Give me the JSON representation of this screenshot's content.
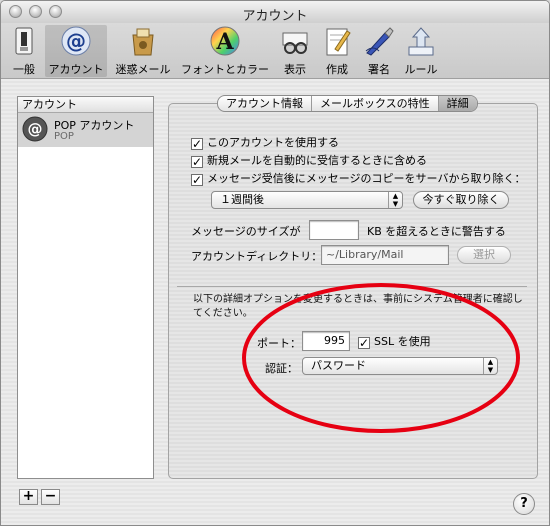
{
  "window": {
    "title": "アカウント"
  },
  "toolbar": {
    "items": [
      {
        "label": "一般",
        "icon": "switch-icon"
      },
      {
        "label": "アカウント",
        "icon": "at-sign-icon"
      },
      {
        "label": "迷惑メール",
        "icon": "junk-bag-icon"
      },
      {
        "label": "フォントとカラー",
        "icon": "font-color-icon"
      },
      {
        "label": "表示",
        "icon": "glasses-icon"
      },
      {
        "label": "作成",
        "icon": "pencil-paper-icon"
      },
      {
        "label": "署名",
        "icon": "pen-icon"
      },
      {
        "label": "ルール",
        "icon": "rules-icon"
      }
    ]
  },
  "accounts": {
    "header": "アカウント",
    "items": [
      {
        "name": "POP アカウント",
        "type": "POP"
      }
    ],
    "add_label": "+",
    "remove_label": "−"
  },
  "tabs": [
    {
      "label": "アカウント情報",
      "active": false
    },
    {
      "label": "メールボックスの特性",
      "active": false
    },
    {
      "label": "詳細",
      "active": true
    }
  ],
  "advanced": {
    "cb_enable": "このアカウントを使用する",
    "cb_include": "新規メールを自動的に受信するときに含める",
    "cb_remove": "メッセージ受信後にメッセージのコピーをサーバから取り除く：",
    "remove_after": "１週間後",
    "remove_now": "今すぐ取り除く",
    "msgsize_label": "メッセージのサイズが",
    "msgsize_value": "",
    "msgsize_suffix": "KB を超えるときに警告する",
    "dir_label": "アカウントディレクトリ：",
    "dir_value": "~/Library/Mail",
    "select_button": "選択",
    "note": "以下の詳細オプションを変更するときは、事前にシステム管理者に確認してください。",
    "port_label": "ポート：",
    "port_value": "995",
    "ssl_label": "SSL を使用",
    "auth_label": "認証：",
    "auth_value": "パスワード"
  },
  "help_label": "?",
  "annotation_color": "#e60012"
}
